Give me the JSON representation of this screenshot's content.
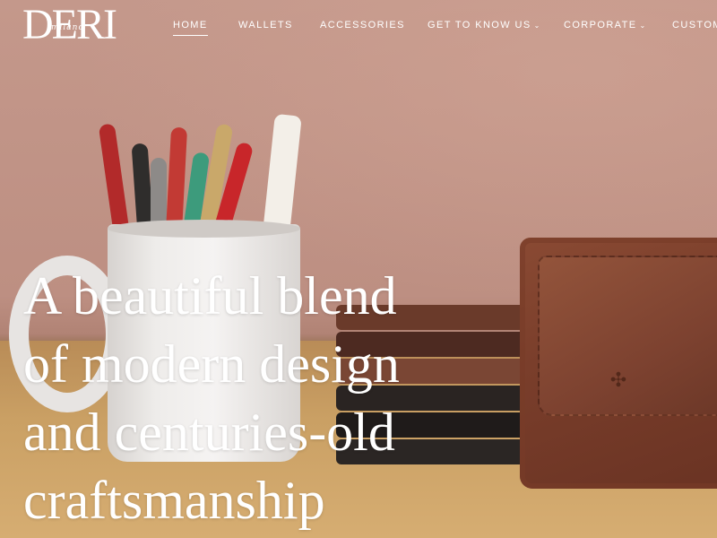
{
  "brand": {
    "logo_main": "DERI",
    "logo_sub": "milano"
  },
  "nav": {
    "items": [
      {
        "label": "HOME",
        "active": true
      },
      {
        "label": "WALLETS",
        "active": false
      },
      {
        "label": "ACCESSORIES",
        "active": false
      },
      {
        "label": "GET TO KNOW US",
        "active": false,
        "dropdown": true
      },
      {
        "label": "CORPORATE",
        "active": false,
        "dropdown": true
      },
      {
        "label": "CUSTOM",
        "active": false
      }
    ]
  },
  "hero": {
    "headline_lines": [
      "A beautiful blend",
      "of modern design",
      "and centuries-old",
      "craftsmanship"
    ]
  },
  "icons": {
    "dropdown": "chevron-down-icon"
  },
  "colors": {
    "nav_text": "#ffffff",
    "headline_text": "#ffffff",
    "wall": "#c4988b",
    "leather": "#7a3e2b"
  }
}
